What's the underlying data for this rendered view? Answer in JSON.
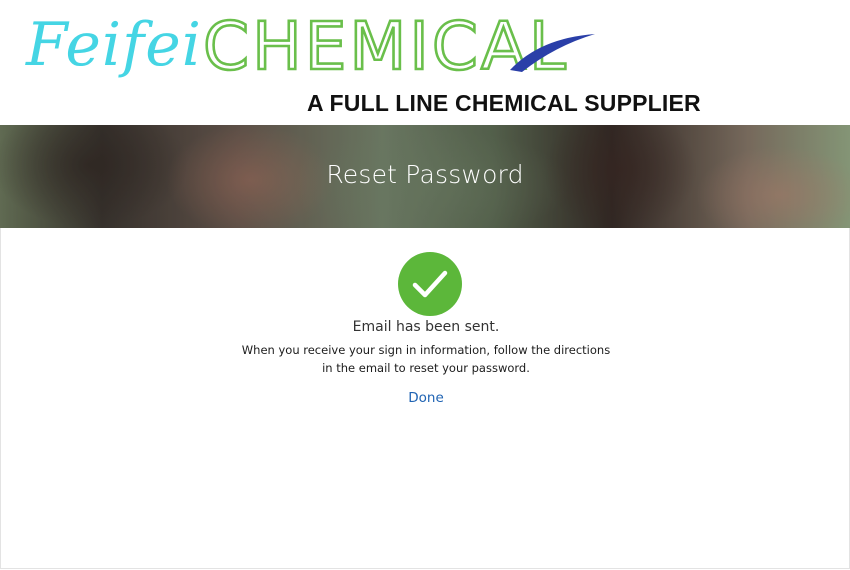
{
  "header": {
    "logo_script": "Feifei",
    "logo_word": "CHEMICAL",
    "tagline": "A FULL LINE CHEMICAL SUPPLIER"
  },
  "banner": {
    "title": "Reset Password"
  },
  "confirmation": {
    "icon": "checkmark-circle-icon",
    "title": "Email has been sent.",
    "line1": "When you receive your sign in information, follow the directions",
    "line2": "in the email to reset your password.",
    "done_label": "Done"
  },
  "colors": {
    "logo_cyan": "#45d5e4",
    "logo_green": "#6abf4b",
    "success_green": "#5cb73a",
    "link_blue": "#1f63b3"
  }
}
